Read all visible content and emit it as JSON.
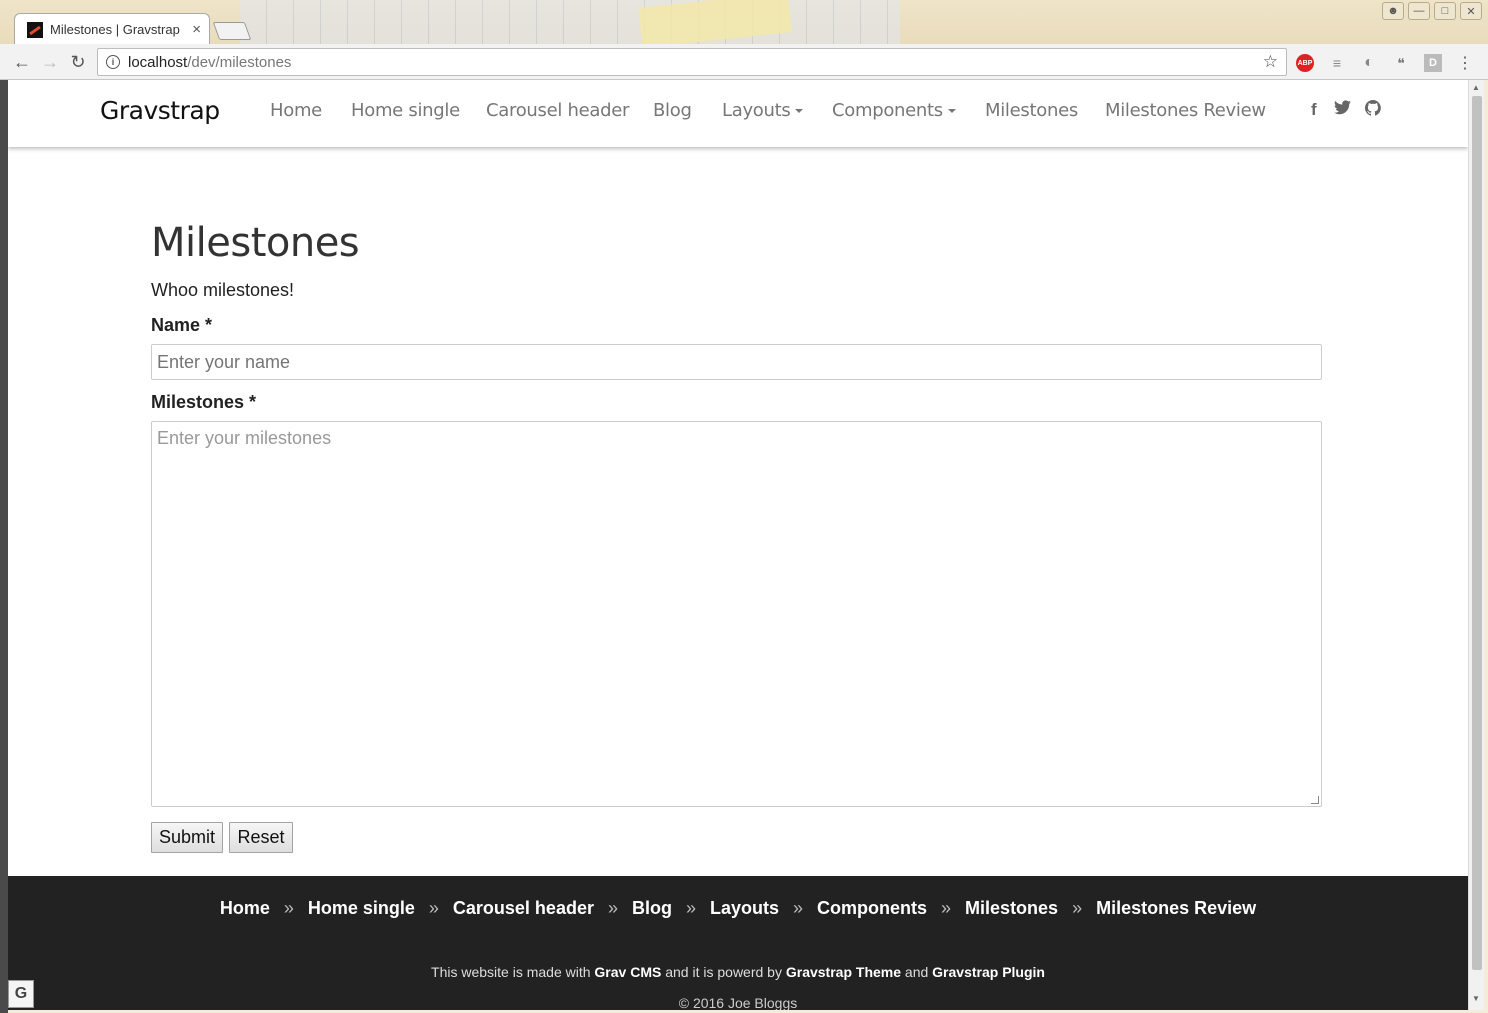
{
  "browser": {
    "tab_title": "Milestones | Gravstrap",
    "url_host": "localhost",
    "url_path": "/dev/milestones",
    "window_buttons": [
      "user-icon",
      "minimize-icon",
      "restore-icon",
      "close-icon"
    ],
    "extensions": [
      "ABP",
      "≡",
      "◐",
      "❝",
      "D",
      "⋮"
    ]
  },
  "navbar": {
    "brand": "Gravstrap",
    "items": [
      {
        "label": "Home"
      },
      {
        "label": "Home single"
      },
      {
        "label": "Carousel header"
      },
      {
        "label": "Blog"
      },
      {
        "label": "Layouts",
        "dropdown": true
      },
      {
        "label": "Components",
        "dropdown": true
      },
      {
        "label": "Milestones"
      },
      {
        "label": "Milestones Review"
      }
    ],
    "social": [
      "facebook-icon",
      "twitter-icon",
      "github-icon"
    ]
  },
  "main": {
    "title": "Milestones",
    "intro": "Whoo milestones!",
    "name_label": "Name *",
    "name_placeholder": "Enter your name",
    "milestones_label": "Milestones *",
    "milestones_placeholder": "Enter your milestones",
    "submit_label": "Submit",
    "reset_label": "Reset"
  },
  "footer": {
    "links": [
      "Home",
      "Home single",
      "Carousel header",
      "Blog",
      "Layouts",
      "Components",
      "Milestones",
      "Milestones Review"
    ],
    "separator": "»",
    "made_prefix": "This website is made with",
    "grav_cms": "Grav CMS",
    "made_mid": "and it is powerd by",
    "theme": "Gravstrap Theme",
    "and": "and",
    "plugin": "Gravstrap Plugin",
    "copyright": "© 2016 Joe Bloggs"
  }
}
